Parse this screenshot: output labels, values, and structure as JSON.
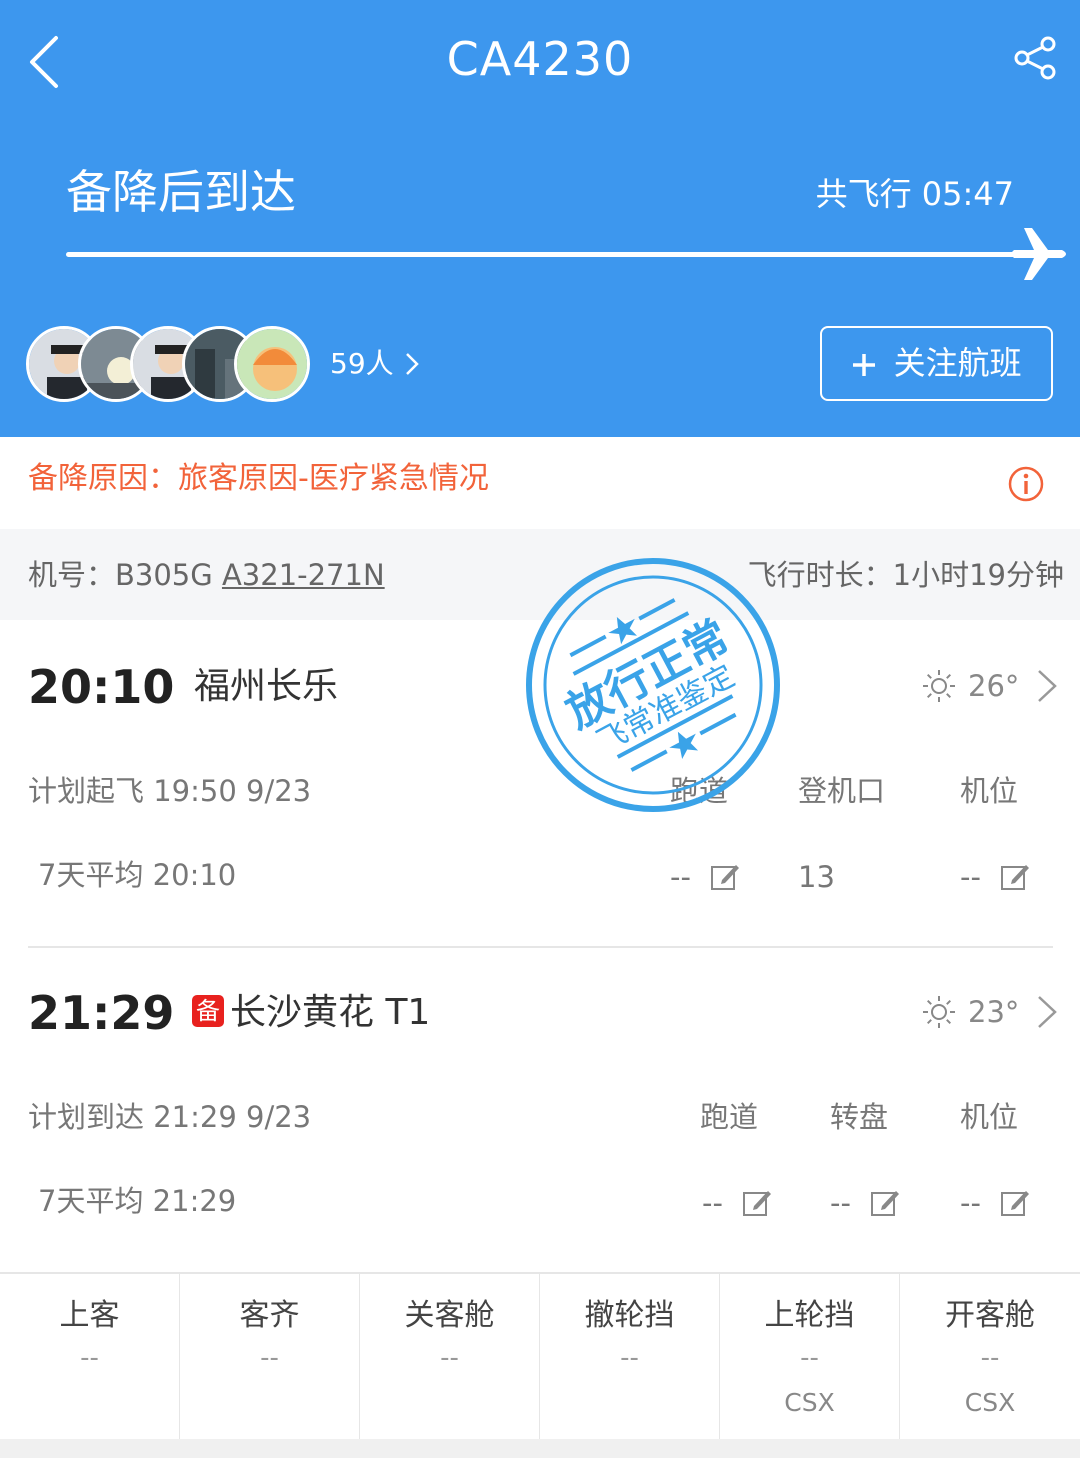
{
  "header": {
    "flight_number": "CA4230",
    "status": "备降后到达",
    "total_flight_time": "共飞行 05:47",
    "followers": "59人",
    "follow_button": "关注航班",
    "colors": {
      "background": "#3d97ee",
      "text": "#ffffff"
    }
  },
  "alternate": {
    "reason": "备降原因：旅客原因-医疗紧急情况",
    "color": "#f2633a"
  },
  "aircraft": {
    "reg_label": "机号：B305G",
    "model": "A321-271N",
    "flight_duration": "飞行时长：1小时19分钟"
  },
  "departure": {
    "time": "20:10",
    "airport": "福州长乐",
    "weather": "26°",
    "scheduled": "计划起飞 19:50 9/23",
    "average": "7天平均 20:10",
    "cols": [
      "跑道",
      "登机口",
      "机位"
    ],
    "values": [
      "--",
      "13",
      "--"
    ]
  },
  "arrival": {
    "badge": "备",
    "time": "21:29",
    "airport": "长沙黄花 T1",
    "weather": "23°",
    "scheduled": "计划到达 21:29 9/23",
    "average": "7天平均 21:29",
    "cols": [
      "跑道",
      "转盘",
      "机位"
    ],
    "values": [
      "--",
      "--",
      "--"
    ]
  },
  "steps": [
    {
      "label": "上客",
      "value": "--",
      "airport": ""
    },
    {
      "label": "客齐",
      "value": "--",
      "airport": ""
    },
    {
      "label": "关客舱",
      "value": "--",
      "airport": ""
    },
    {
      "label": "撤轮挡",
      "value": "--",
      "airport": ""
    },
    {
      "label": "上轮挡",
      "value": "--",
      "airport": "CSX"
    },
    {
      "label": "开客舱",
      "value": "--",
      "airport": "CSX"
    }
  ],
  "stamp": {
    "main": "放行正常",
    "sub": "飞常准鉴定",
    "color": "#3aa3e8"
  },
  "icons": [
    "back-icon",
    "share-icon",
    "plane-icon",
    "info-icon",
    "sun-icon",
    "chevron-right-icon",
    "edit-icon"
  ]
}
